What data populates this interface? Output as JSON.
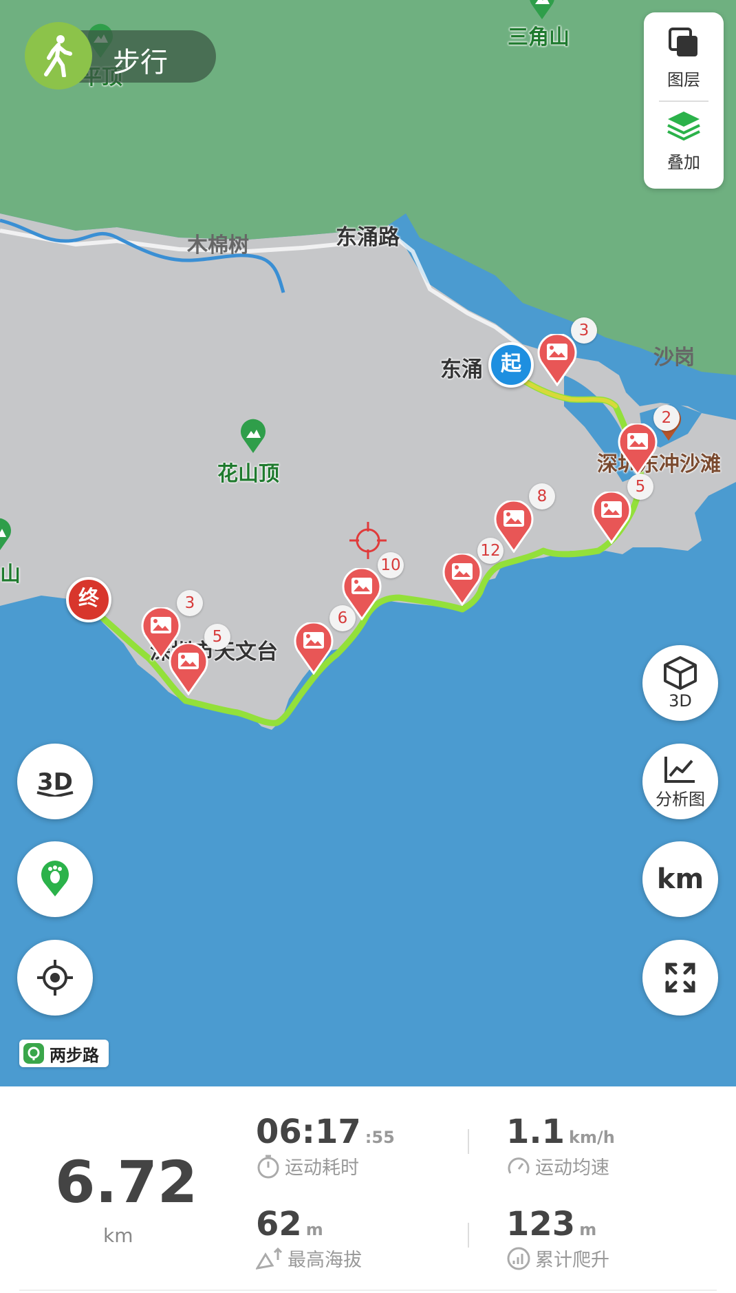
{
  "mode": {
    "label": "步行"
  },
  "layer_panel": {
    "layers_label": "图层",
    "overlay_label": "叠加"
  },
  "map_labels": {
    "sanjiaoshan": "三角山",
    "pingding": "平顶",
    "mumianshu": "木棉树",
    "dongyonglu": "东涌路",
    "shagang": "沙岗",
    "dongyong": "东涌",
    "huashanding": "花山顶",
    "dongchong_beach": "深圳东冲沙滩",
    "observatory": "深圳市天文台",
    "left_mountain": "山"
  },
  "markers": {
    "start": "起",
    "end": "终"
  },
  "photo_counts": [
    "3",
    "2",
    "5",
    "8",
    "12",
    "10",
    "6",
    "3",
    "5"
  ],
  "right_buttons": {
    "three_d": "3D",
    "analysis": "分析图",
    "unit": "km"
  },
  "brand": {
    "name": "两步路"
  },
  "stats": {
    "distance": {
      "value": "6.72",
      "unit": "km"
    },
    "duration": {
      "main": "06:17",
      "seconds": ":55",
      "label": "运动耗时"
    },
    "avg_speed": {
      "value": "1.1",
      "unit": "km/h",
      "label": "运动均速"
    },
    "max_altitude": {
      "value": "62",
      "unit": "m",
      "label": "最高海拔"
    },
    "total_climb": {
      "value": "123",
      "unit": "m",
      "label": "累计爬升"
    }
  },
  "colors": {
    "sea": "#4b9bd0",
    "land": "#c6c7c9",
    "forest": "#6fb080",
    "track": "#93e03a",
    "pin": "#e85656",
    "start": "#1e8fe0",
    "end": "#d8362c"
  }
}
